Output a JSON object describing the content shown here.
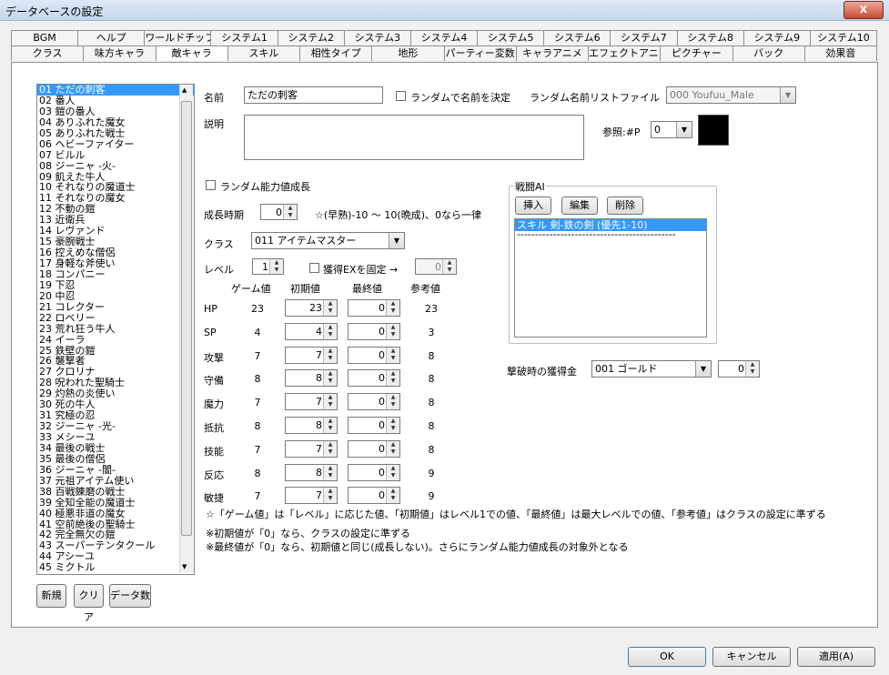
{
  "window": {
    "title": "データベースの設定",
    "close": "x"
  },
  "tabs_row1": [
    "BGM",
    "ヘルプ",
    "ワールドチップ",
    "システム1",
    "システム2",
    "システム3",
    "システム4",
    "システム5",
    "システム6",
    "システム7",
    "システム8",
    "システム9",
    "システム10"
  ],
  "tabs_row2": [
    "クラス",
    "味方キャラ",
    "敵キャラ",
    "スキル",
    "相性タイプ",
    "地形",
    "パーティー変数",
    "キャラアニメ",
    "エフェクトアニメ",
    "ピクチャー",
    "バック",
    "効果音"
  ],
  "active_tab": "敵キャラ",
  "enemy_list": [
    "01 ただの刺客",
    "02 番人",
    "03 鎧の番人",
    "04 ありふれた魔女",
    "05 ありふれた戦士",
    "06 ヘビーファイター",
    "07 ビルル",
    "08 ジーニャ -火-",
    "09 飢えた牛人",
    "10 それなりの魔道士",
    "11 それなりの魔女",
    "12 不動の鎧",
    "13 近衛兵",
    "14 レヴァンド",
    "15 豪腕戦士",
    "16 控えめな僧侶",
    "17 身軽な斧使い",
    "18 コンパニー",
    "19 下忍",
    "20 中忍",
    "21 コレクター",
    "22 ロベリー",
    "23 荒れ狂う牛人",
    "24 イーラ",
    "25 鉄壁の鎧",
    "26 襲撃者",
    "27 クロリナ",
    "28 呪われた聖騎士",
    "29 灼熱の炎使い",
    "30 死の牛人",
    "31 究極の忍",
    "32 ジーニャ -光-",
    "33 メシーユ",
    "34 最後の戦士",
    "35 最後の僧侶",
    "36 ジーニャ -闇-",
    "37 元祖アイテム使い",
    "38 百戦錬磨の戦士",
    "39 全知全能の魔道士",
    "40 極悪非道の魔女",
    "41 空前絶後の聖騎士",
    "42 完全無欠の鎧",
    "43 スーパーテンタクール",
    "44 アシーユ",
    "45 ミクトル"
  ],
  "list_buttons": {
    "new": "新規",
    "clear": "クリア",
    "count": "データ数"
  },
  "name": {
    "label": "名前",
    "value": "ただの刺客"
  },
  "random_name": {
    "label": "ランダムで名前を決定",
    "list_label": "ランダム名前リストファイル",
    "list_value": "000 Youfuu_Male"
  },
  "description": {
    "label": "説明",
    "value": ""
  },
  "reference": {
    "label": "参照:#P",
    "value": "0",
    "swatch_color": "#000000"
  },
  "random_growth": {
    "label": "ランダム能力値成長"
  },
  "growth": {
    "label": "成長時期",
    "value": "0",
    "note": "☆(早熟)-10 ～ 10(晩成)、0なら一律"
  },
  "class": {
    "label": "クラス",
    "value": "011 アイテムマスター"
  },
  "level": {
    "label": "レベル",
    "value": "1",
    "fix_ex_label": "獲得EXを固定 →",
    "fix_ex_value": "0"
  },
  "stat_headers": {
    "game": "ゲーム値",
    "initial": "初期値",
    "final": "最終値",
    "ref": "参考値"
  },
  "stats": [
    {
      "name": "HP",
      "game": "23",
      "initial": "23",
      "final": "0",
      "ref": "23"
    },
    {
      "name": "SP",
      "game": "4",
      "initial": "4",
      "final": "0",
      "ref": "3"
    },
    {
      "name": "攻撃",
      "game": "7",
      "initial": "7",
      "final": "0",
      "ref": "8"
    },
    {
      "name": "守備",
      "game": "8",
      "initial": "8",
      "final": "0",
      "ref": "8"
    },
    {
      "name": "魔力",
      "game": "7",
      "initial": "7",
      "final": "0",
      "ref": "8"
    },
    {
      "name": "抵抗",
      "game": "8",
      "initial": "8",
      "final": "0",
      "ref": "8"
    },
    {
      "name": "技能",
      "game": "7",
      "initial": "7",
      "final": "0",
      "ref": "8"
    },
    {
      "name": "反応",
      "game": "8",
      "initial": "8",
      "final": "0",
      "ref": "9"
    },
    {
      "name": "敏捷",
      "game": "7",
      "initial": "7",
      "final": "0",
      "ref": "9"
    }
  ],
  "notes": [
    "☆「ゲーム値」は「レベル」に応じた値、「初期値」はレベル1での値、「最終値」は最大レベルでの値、「参考値」はクラスの設定に準ずる",
    "※初期値が「0」なら、クラスの設定に準ずる",
    "※最終値が「0」なら、初期値と同じ(成長しない)。さらにランダム能力値成長の対象外となる"
  ],
  "ai": {
    "label": "戦闘AI",
    "insert": "挿入",
    "edit": "編集",
    "delete": "削除",
    "items": [
      "スキル 剣-鉄の剣 (優先1-10)",
      "--------------------------------------------"
    ]
  },
  "gold": {
    "label": "撃破時の獲得金",
    "value": "001 ゴールド",
    "amount": "0"
  },
  "footer": {
    "ok": "OK",
    "cancel": "キャンセル",
    "apply": "適用(A)"
  }
}
